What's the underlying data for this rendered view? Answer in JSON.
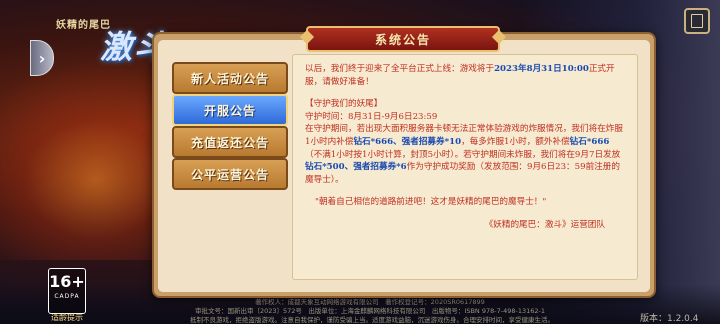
{
  "logo": {
    "subtitle": "妖精的尾巴",
    "main": "激斗"
  },
  "dialog": {
    "title": "系统公告",
    "tabs": [
      {
        "label": "新人活动公告",
        "active": false
      },
      {
        "label": "开服公告",
        "active": true
      },
      {
        "label": "充值返还公告",
        "active": false
      },
      {
        "label": "公平运营公告",
        "active": false
      }
    ],
    "content": {
      "intro_before": "以后，我们终于迎来了全平台正式上线：游戏将于",
      "intro_highlight": "2023年8月31日10:00",
      "intro_after": "正式开服，请做好准备！",
      "section_title": "【守护我们的妖尾】",
      "guard_time": "守护时间：8月31日-9月6日23:59",
      "p1_before": "在守护期间，若出现大面积服务器卡顿无法正常体验游戏的炸服情况，我们将在炸服1小时内补偿",
      "p1_h1": "钻石*666、强者招募券*10",
      "p1_mid": "，每多炸服1小时，额外补偿",
      "p1_h2": "钻石*666",
      "p1_after": "（不满1小时按1小时计算，封顶5小时）。若守护期间未炸服，我们将在9月7日发放",
      "p1_h3": "钻石*500、强者招募券*6",
      "p1_end": "作为守护成功奖励（发放范围：9月6日23：59前注册的魔导士）。",
      "quote": "\"朝着自己相信的道路前进吧！这才是妖精的尾巴的魔导士！\"",
      "signature": "《妖精的尾巴：激斗》运营团队"
    }
  },
  "footer": {
    "line1": "著作权人：成都天象互动网络游戏有限公司　著作权登记号：2020SR0617899",
    "line2": "审批文号：国新出审〔2023〕572号　出版单位：上海金麒麟网络科技有限公司　出版物号：ISBN 978-7-498-13162-1",
    "line3": "抵制不良游戏，拒绝盗版游戏。注意自我保护，谨防受骗上当。适度游戏益脑，沉迷游戏伤身。合理安排时间，享受健康生活。"
  },
  "age_rating": {
    "number": "16+",
    "code": "CADPA",
    "label": "适龄提示"
  },
  "version": "版本：1.2.0.4",
  "icons": [
    "back-arrow-icon",
    "notice-book-icon"
  ],
  "colors": {
    "text_red": "#c03020",
    "highlight_blue": "#1a4ab0",
    "tab_active": "#2f6ad8",
    "tab_normal": "#c8893d"
  }
}
